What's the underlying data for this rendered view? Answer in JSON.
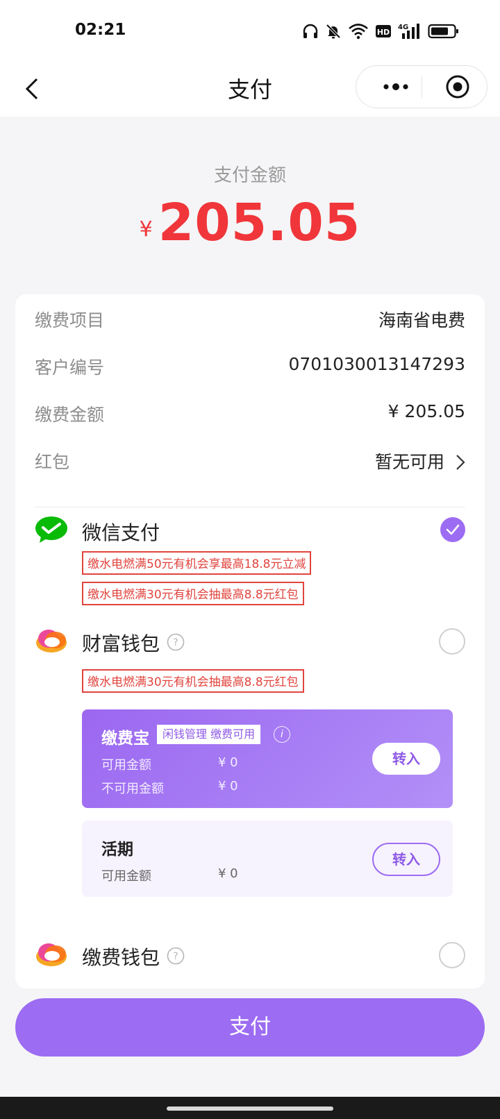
{
  "status_bar": {
    "time": "02:21"
  },
  "nav": {
    "title": "支付"
  },
  "amount": {
    "label": "支付金额",
    "currency": "¥",
    "value": "205.05"
  },
  "details": [
    {
      "label": "缴费项目",
      "value": "海南省电费"
    },
    {
      "label": "客户编号",
      "value": "0701030013147293"
    },
    {
      "label": "缴费金额",
      "value": "¥ 205.05"
    },
    {
      "label": "红包",
      "value": "暂无可用"
    }
  ],
  "methods": {
    "wechat": {
      "name": "微信支付",
      "selected": true,
      "promos": [
        "缴水电燃满50元有机会享最高18.8元立减",
        "缴水电燃满30元有机会抽最高8.8元红包"
      ]
    },
    "wealth_wallet": {
      "name": "财富钱包",
      "selected": false,
      "promos": [
        "缴水电燃满30元有机会抽最高8.8元红包"
      ],
      "jiaofeibao": {
        "title": "缴费宝",
        "tag": "闲钱管理 缴费可用",
        "available_label": "可用金额",
        "available_value": "¥ 0",
        "unavailable_label": "不可用金额",
        "unavailable_value": "¥ 0",
        "button": "转入"
      },
      "huoqi": {
        "title": "活期",
        "available_label": "可用金额",
        "available_value": "¥ 0",
        "button": "转入"
      }
    },
    "fee_wallet": {
      "name": "缴费钱包",
      "selected": false
    }
  },
  "pay_button": "支付",
  "colors": {
    "accent": "#9c6cf2",
    "amount_red": "#f0363a",
    "promo_red": "#e0443e",
    "wechat_green": "#09bb07"
  }
}
